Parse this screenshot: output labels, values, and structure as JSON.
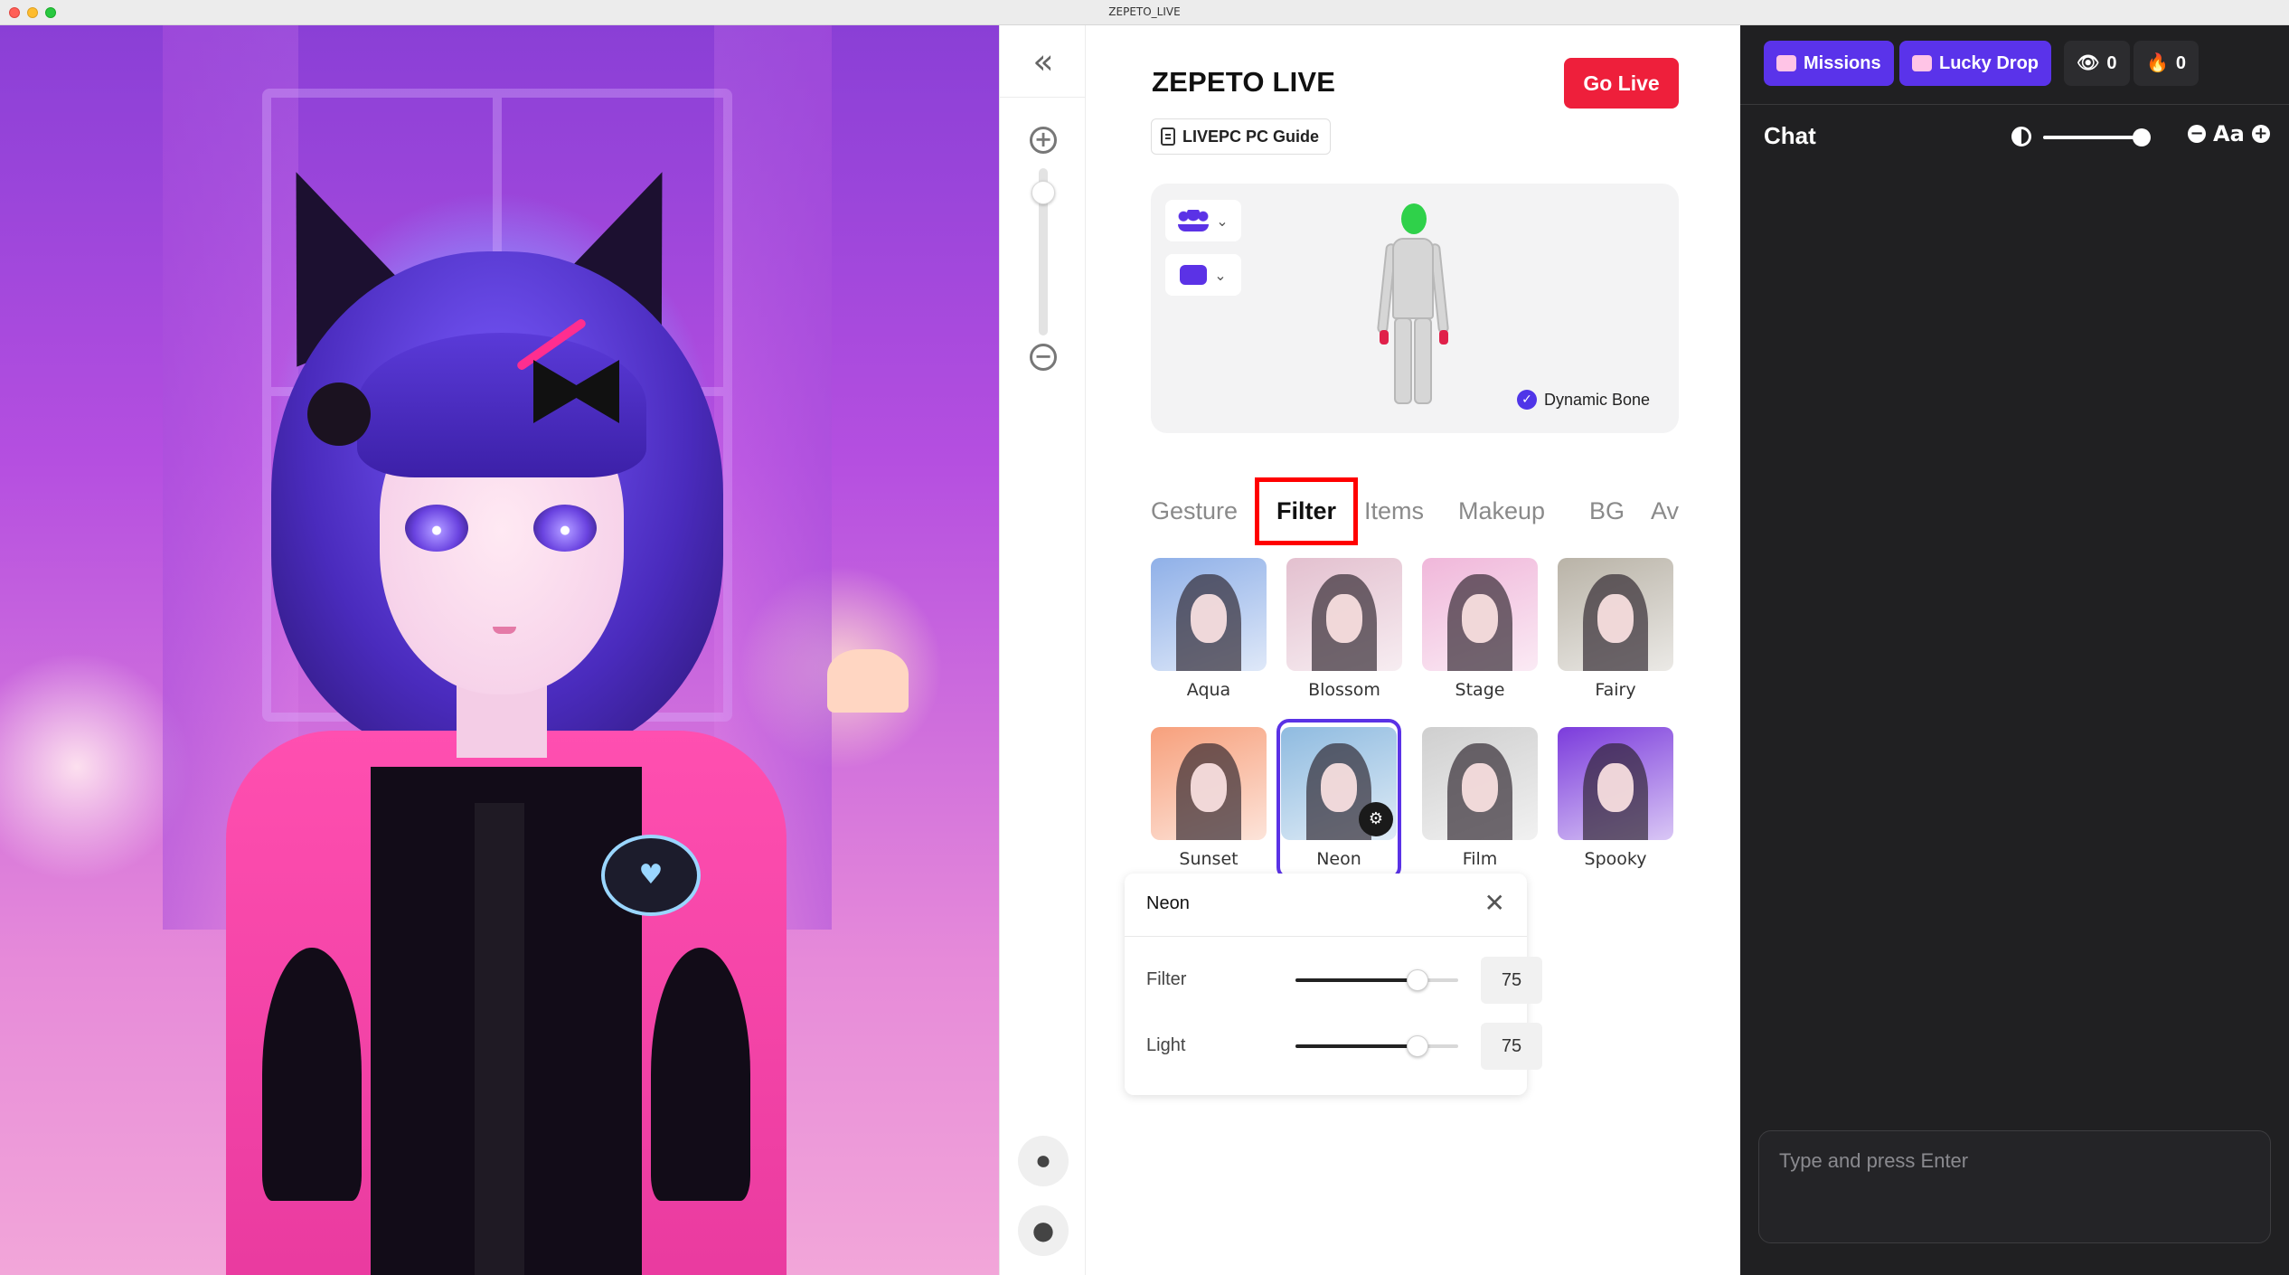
{
  "window": {
    "title": "ZEPETO_LIVE"
  },
  "toolstrip": {
    "collapse_icon": "double-chevron-left",
    "zoom_in_icon": "plus-circle",
    "zoom_out_icon": "minus-circle"
  },
  "panel": {
    "title": "ZEPETO LIVE",
    "go_live_label": "Go Live",
    "guide_label": "LIVEPC PC Guide",
    "dynamic_bone_label": "Dynamic Bone",
    "dynamic_bone_checked": true,
    "tabs": [
      {
        "label": "Gesture",
        "active": false
      },
      {
        "label": "Filter",
        "active": true
      },
      {
        "label": "Items",
        "active": false
      },
      {
        "label": "Makeup",
        "active": false
      },
      {
        "label": "BG",
        "active": false
      },
      {
        "label": "Av",
        "active": false
      }
    ],
    "filters": [
      {
        "label": "Aqua",
        "color": "#8fb0e8"
      },
      {
        "label": "Blossom",
        "color": "#e3c0cf"
      },
      {
        "label": "Stage",
        "color": "#f0b7da"
      },
      {
        "label": "Fairy",
        "color": "#b9b3a7"
      },
      {
        "label": "Sunset",
        "color": "#f7a07c"
      },
      {
        "label": "Neon",
        "color": "#8fbbe0",
        "selected": true
      },
      {
        "label": "Film",
        "color": "#cfcfcf"
      },
      {
        "label": "Spooky",
        "color": "#7b3bdc"
      }
    ],
    "adjust": {
      "name": "Neon",
      "rows": [
        {
          "label": "Filter",
          "value": "75",
          "level": 0.75
        },
        {
          "label": "Light",
          "value": "75",
          "level": 0.75
        }
      ]
    }
  },
  "chat": {
    "missions_label": "Missions",
    "lucky_drop_label": "Lucky Drop",
    "viewers_count": "0",
    "likes_count": "0",
    "title": "Chat",
    "font_label": "Aa",
    "opacity_level": 0.95,
    "input_placeholder": "Type and press Enter"
  },
  "colors": {
    "accent": "#5a33ea",
    "go_live": "#ee1f3b",
    "highlight_box": "#ff0000"
  }
}
